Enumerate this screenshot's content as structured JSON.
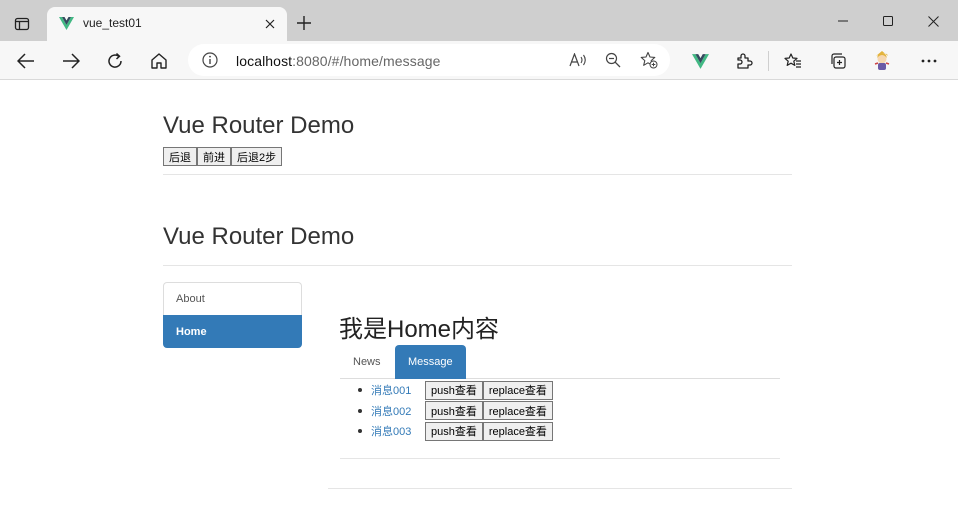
{
  "browser": {
    "tab_title": "vue_test01",
    "url_host": "localhost",
    "url_rest": ":8080/#/home/message"
  },
  "page": {
    "header_title_1": "Vue Router Demo",
    "history_buttons": [
      "后退",
      "前进",
      "后退2步"
    ],
    "header_title_2": "Vue Router Demo",
    "sidebar": [
      {
        "label": "About",
        "active": false
      },
      {
        "label": "Home",
        "active": true
      }
    ],
    "home_title": "我是Home内容",
    "subtabs": [
      {
        "label": "News",
        "active": false
      },
      {
        "label": "Message",
        "active": true
      }
    ],
    "messages": [
      {
        "label": "消息001",
        "push": "push查看",
        "replace": "replace查看"
      },
      {
        "label": "消息002",
        "push": "push查看",
        "replace": "replace查看"
      },
      {
        "label": "消息003",
        "push": "push查看",
        "replace": "replace查看"
      }
    ]
  },
  "colors": {
    "accent": "#337ab7",
    "vue_green": "#41b883",
    "vue_dark": "#35495e"
  }
}
